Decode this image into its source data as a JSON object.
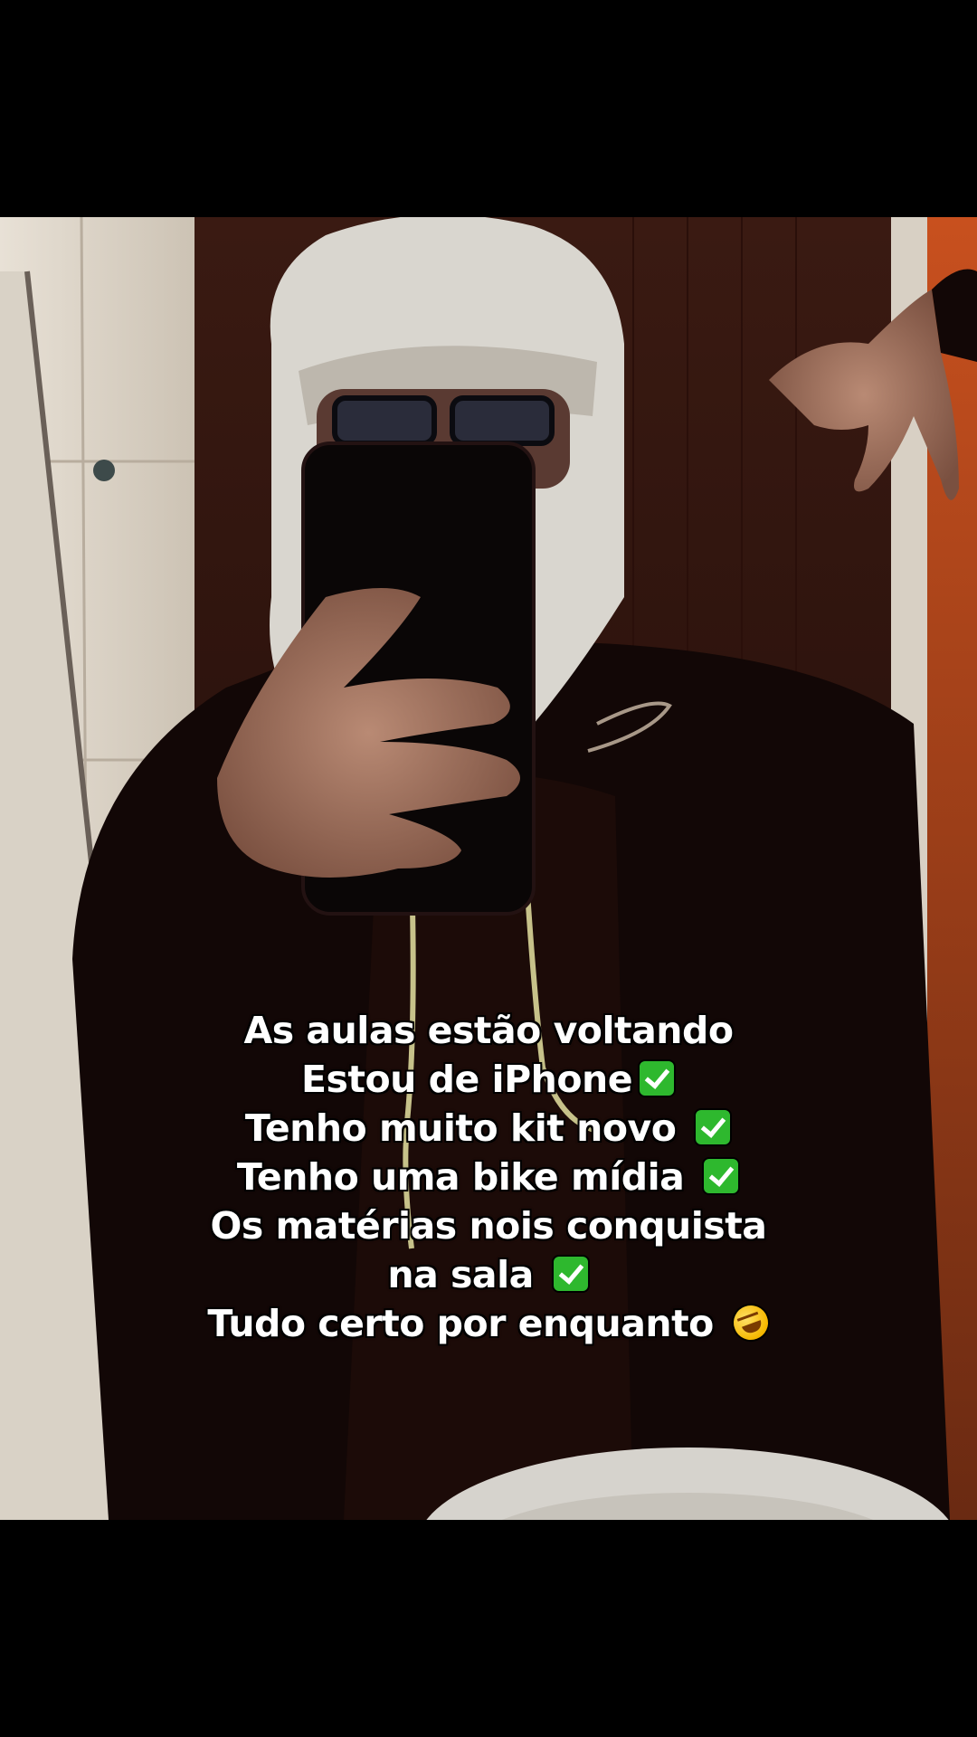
{
  "caption": {
    "lines": [
      {
        "text": "As aulas estão voltando",
        "emoji": null
      },
      {
        "text": "Estou de iPhone",
        "emoji": "check-mark-icon"
      },
      {
        "text": "Tenho muito kit novo ",
        "emoji": "check-mark-icon"
      },
      {
        "text": "Tenho uma bike mídia ",
        "emoji": "check-mark-icon"
      },
      {
        "text": "Os matérias nois conquista",
        "emoji": null
      },
      {
        "text": "na sala ",
        "emoji": "check-mark-icon"
      },
      {
        "text": "Tudo certo por enquanto ",
        "emoji": "rofl-emoji-icon"
      }
    ]
  },
  "colors": {
    "background": "#000000",
    "caption_text": "#ffffff",
    "caption_outline": "#000000",
    "check_green": "#2eb82e"
  }
}
